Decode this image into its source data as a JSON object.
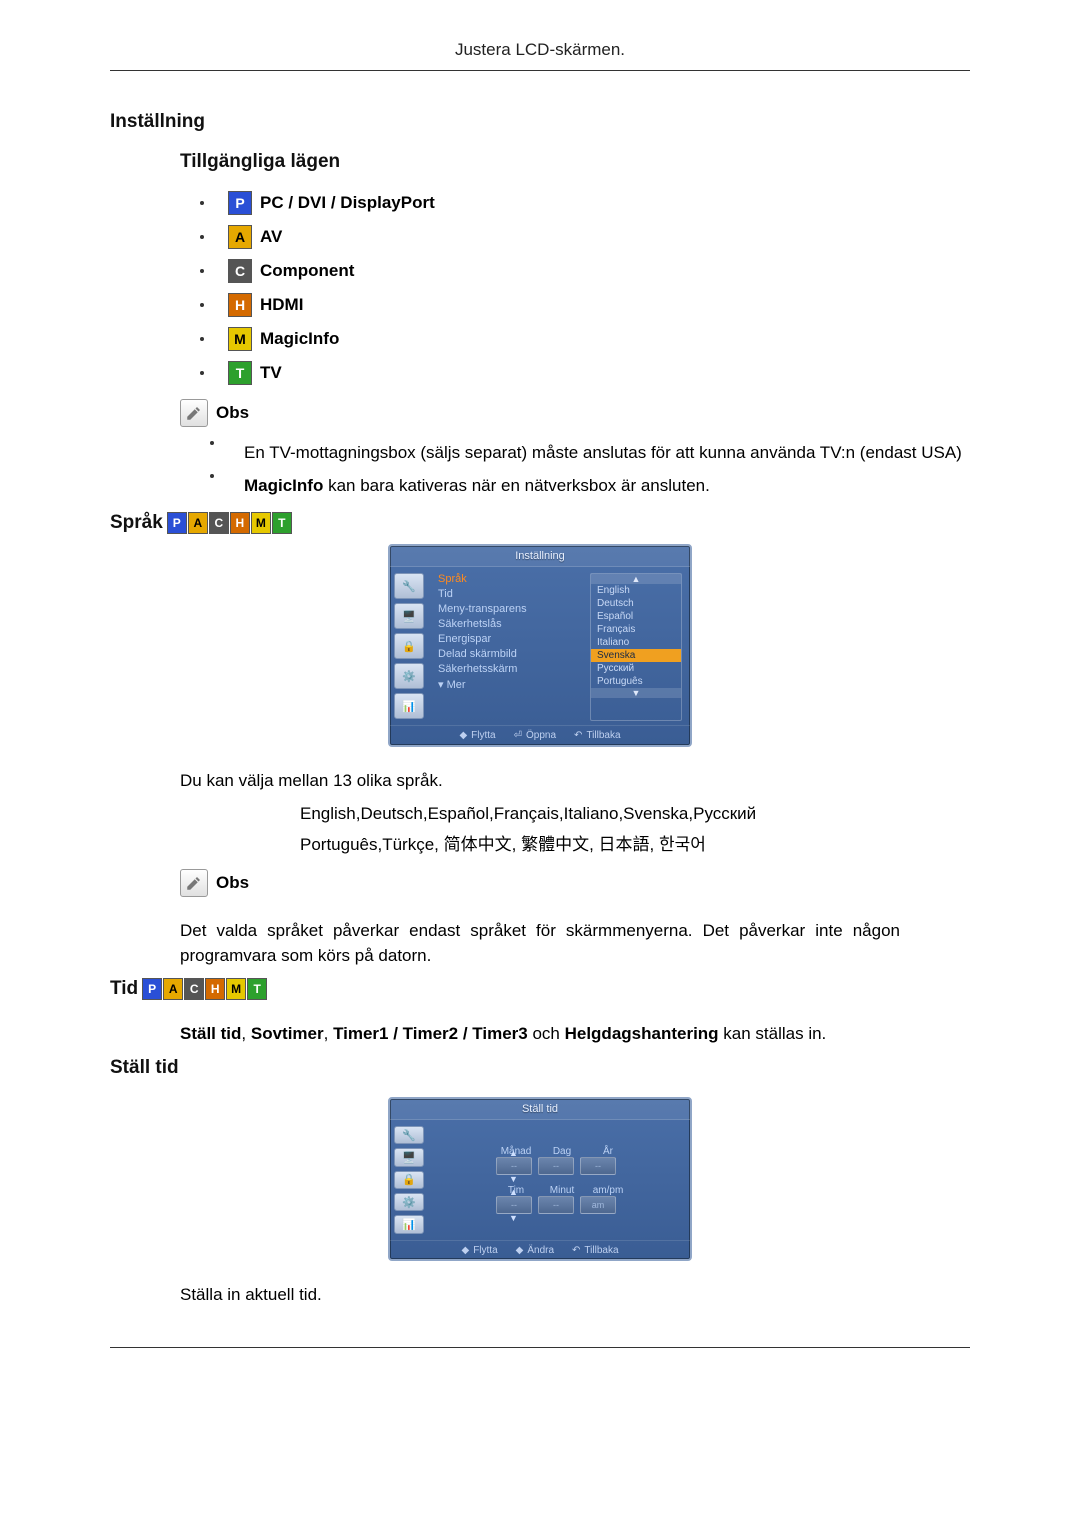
{
  "header": "Justera LCD-skärmen.",
  "h_installning": "Inställning",
  "h_available_modes": "Tillgängliga lägen",
  "modes": {
    "pc": "PC / DVI / DisplayPort",
    "av": "AV",
    "component": "Component",
    "hdmi": "HDMI",
    "magicinfo": "MagicInfo",
    "tv": "TV"
  },
  "obs_label": "Obs",
  "obs_items": {
    "a": "En TV-mottagningsbox (säljs separat) måste anslutas för att kunna använda TV:n (endast USA)",
    "b_prefix": "MagicInfo",
    "b_rest": " kan bara kativeras när en nätverksbox är ansluten."
  },
  "sprak_title": "Språk",
  "osd1": {
    "title": "Inställning",
    "menu": {
      "sprak": "Språk",
      "tid": "Tid",
      "menytrans": "Meny-transparens",
      "sakerhetslas": "Säkerhetslås",
      "energispar": "Energispar",
      "delad": "Delad skärmbild",
      "sakskarm": "Säkerhetsskärm",
      "mer": "▾ Mer"
    },
    "opts": {
      "english": "English",
      "deutsch": "Deutsch",
      "espanol": "Español",
      "francais": "Français",
      "italiano": "Italiano",
      "svenska": "Svenska",
      "russkij": "Русский",
      "portugues": "Português"
    },
    "footer": {
      "flytta": "Flytta",
      "oppna": "Öppna",
      "tillbaka": "Tillbaka"
    }
  },
  "sprak_desc": "Du kan välja mellan 13 olika språk.",
  "lang_line1": "English,Deutsch,Español,Français,Italiano,Svenska,Русский",
  "lang_line2": "Português,Türkçe, 简体中文,   繁體中文, 日本語, 한국어",
  "sprak_note": "Det valda språket påverkar endast språket för skärmmenyerna. Det påverkar inte någon programvara som körs på datorn.",
  "tid_title": "Tid",
  "tid_intro_parts": {
    "a": "Ställ tid",
    "b": "Sovtimer",
    "c": "Timer1 / Timer2 / Timer3",
    "d": "Helgdagshantering",
    "sep": ", ",
    "mid": " och ",
    "tail": " kan ställas in."
  },
  "stall_tid_title": "Ställ tid",
  "osd2": {
    "title": "Ställ tid",
    "labels": {
      "manad": "Månad",
      "dag": "Dag",
      "ar": "År",
      "tim": "Tim",
      "minut": "Minut",
      "ampm": "am/pm"
    },
    "vals": {
      "dash": "--",
      "am": "am"
    },
    "footer": {
      "flytta": "Flytta",
      "andra": "Ändra",
      "tillbaka": "Tillbaka"
    }
  },
  "stall_tid_desc": "Ställa in aktuell tid."
}
